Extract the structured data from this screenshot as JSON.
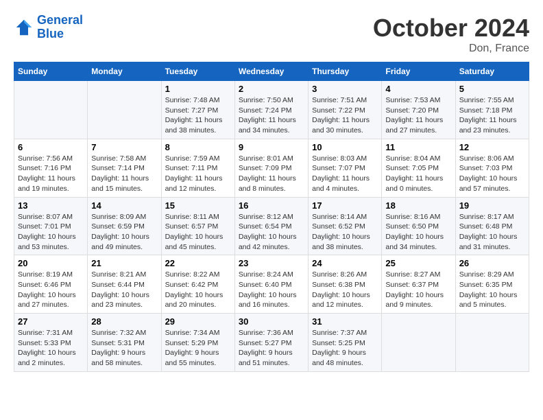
{
  "header": {
    "logo_line1": "General",
    "logo_line2": "Blue",
    "month_title": "October 2024",
    "location": "Don, France"
  },
  "weekdays": [
    "Sunday",
    "Monday",
    "Tuesday",
    "Wednesday",
    "Thursday",
    "Friday",
    "Saturday"
  ],
  "weeks": [
    [
      {
        "day": "",
        "info": ""
      },
      {
        "day": "",
        "info": ""
      },
      {
        "day": "1",
        "info": "Sunrise: 7:48 AM\nSunset: 7:27 PM\nDaylight: 11 hours and 38 minutes."
      },
      {
        "day": "2",
        "info": "Sunrise: 7:50 AM\nSunset: 7:24 PM\nDaylight: 11 hours and 34 minutes."
      },
      {
        "day": "3",
        "info": "Sunrise: 7:51 AM\nSunset: 7:22 PM\nDaylight: 11 hours and 30 minutes."
      },
      {
        "day": "4",
        "info": "Sunrise: 7:53 AM\nSunset: 7:20 PM\nDaylight: 11 hours and 27 minutes."
      },
      {
        "day": "5",
        "info": "Sunrise: 7:55 AM\nSunset: 7:18 PM\nDaylight: 11 hours and 23 minutes."
      }
    ],
    [
      {
        "day": "6",
        "info": "Sunrise: 7:56 AM\nSunset: 7:16 PM\nDaylight: 11 hours and 19 minutes."
      },
      {
        "day": "7",
        "info": "Sunrise: 7:58 AM\nSunset: 7:14 PM\nDaylight: 11 hours and 15 minutes."
      },
      {
        "day": "8",
        "info": "Sunrise: 7:59 AM\nSunset: 7:11 PM\nDaylight: 11 hours and 12 minutes."
      },
      {
        "day": "9",
        "info": "Sunrise: 8:01 AM\nSunset: 7:09 PM\nDaylight: 11 hours and 8 minutes."
      },
      {
        "day": "10",
        "info": "Sunrise: 8:03 AM\nSunset: 7:07 PM\nDaylight: 11 hours and 4 minutes."
      },
      {
        "day": "11",
        "info": "Sunrise: 8:04 AM\nSunset: 7:05 PM\nDaylight: 11 hours and 0 minutes."
      },
      {
        "day": "12",
        "info": "Sunrise: 8:06 AM\nSunset: 7:03 PM\nDaylight: 10 hours and 57 minutes."
      }
    ],
    [
      {
        "day": "13",
        "info": "Sunrise: 8:07 AM\nSunset: 7:01 PM\nDaylight: 10 hours and 53 minutes."
      },
      {
        "day": "14",
        "info": "Sunrise: 8:09 AM\nSunset: 6:59 PM\nDaylight: 10 hours and 49 minutes."
      },
      {
        "day": "15",
        "info": "Sunrise: 8:11 AM\nSunset: 6:57 PM\nDaylight: 10 hours and 45 minutes."
      },
      {
        "day": "16",
        "info": "Sunrise: 8:12 AM\nSunset: 6:54 PM\nDaylight: 10 hours and 42 minutes."
      },
      {
        "day": "17",
        "info": "Sunrise: 8:14 AM\nSunset: 6:52 PM\nDaylight: 10 hours and 38 minutes."
      },
      {
        "day": "18",
        "info": "Sunrise: 8:16 AM\nSunset: 6:50 PM\nDaylight: 10 hours and 34 minutes."
      },
      {
        "day": "19",
        "info": "Sunrise: 8:17 AM\nSunset: 6:48 PM\nDaylight: 10 hours and 31 minutes."
      }
    ],
    [
      {
        "day": "20",
        "info": "Sunrise: 8:19 AM\nSunset: 6:46 PM\nDaylight: 10 hours and 27 minutes."
      },
      {
        "day": "21",
        "info": "Sunrise: 8:21 AM\nSunset: 6:44 PM\nDaylight: 10 hours and 23 minutes."
      },
      {
        "day": "22",
        "info": "Sunrise: 8:22 AM\nSunset: 6:42 PM\nDaylight: 10 hours and 20 minutes."
      },
      {
        "day": "23",
        "info": "Sunrise: 8:24 AM\nSunset: 6:40 PM\nDaylight: 10 hours and 16 minutes."
      },
      {
        "day": "24",
        "info": "Sunrise: 8:26 AM\nSunset: 6:38 PM\nDaylight: 10 hours and 12 minutes."
      },
      {
        "day": "25",
        "info": "Sunrise: 8:27 AM\nSunset: 6:37 PM\nDaylight: 10 hours and 9 minutes."
      },
      {
        "day": "26",
        "info": "Sunrise: 8:29 AM\nSunset: 6:35 PM\nDaylight: 10 hours and 5 minutes."
      }
    ],
    [
      {
        "day": "27",
        "info": "Sunrise: 7:31 AM\nSunset: 5:33 PM\nDaylight: 10 hours and 2 minutes."
      },
      {
        "day": "28",
        "info": "Sunrise: 7:32 AM\nSunset: 5:31 PM\nDaylight: 9 hours and 58 minutes."
      },
      {
        "day": "29",
        "info": "Sunrise: 7:34 AM\nSunset: 5:29 PM\nDaylight: 9 hours and 55 minutes."
      },
      {
        "day": "30",
        "info": "Sunrise: 7:36 AM\nSunset: 5:27 PM\nDaylight: 9 hours and 51 minutes."
      },
      {
        "day": "31",
        "info": "Sunrise: 7:37 AM\nSunset: 5:25 PM\nDaylight: 9 hours and 48 minutes."
      },
      {
        "day": "",
        "info": ""
      },
      {
        "day": "",
        "info": ""
      }
    ]
  ]
}
